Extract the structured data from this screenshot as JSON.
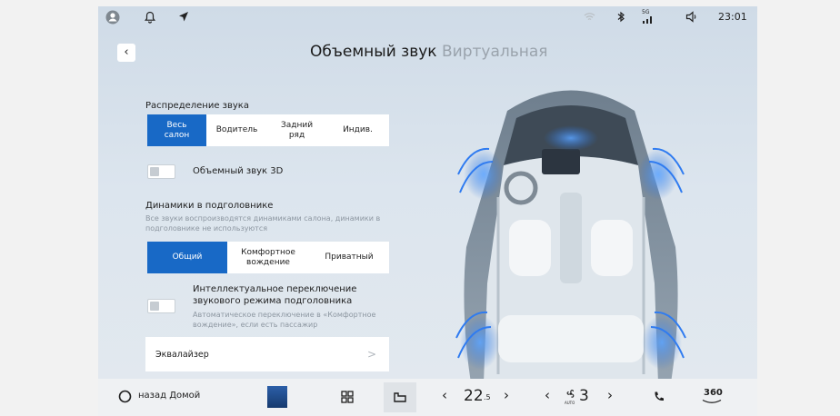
{
  "status_bar": {
    "time": "23:01",
    "signal_label": "5G"
  },
  "header": {
    "back_label": "‹",
    "tabs": [
      {
        "label": "Объемный звук"
      },
      {
        "label": "Виртуальная"
      }
    ]
  },
  "sound_distribution": {
    "label": "Распределение звука",
    "options": [
      {
        "label": "Весь\nсалон",
        "active": true
      },
      {
        "label": "Водитель"
      },
      {
        "label": "Задний\nряд"
      },
      {
        "label": "Индив."
      }
    ]
  },
  "surround_3d": {
    "label": "Объемный звук 3D",
    "enabled": false
  },
  "headrest": {
    "label": "Динамики в подголовнике",
    "description": "Все звуки воспроизводятся динамиками салона, динамики в подголовнике не используются",
    "options": [
      {
        "label": "Общий",
        "active": true
      },
      {
        "label": "Комфортное\nвождение"
      },
      {
        "label": "Приватный"
      }
    ]
  },
  "smart_switch": {
    "label": "Интеллектуальное переключение звукового режима подголовника",
    "description": "Автоматическое переключение в «Комфортное вождение», если есть пассажир",
    "enabled": false
  },
  "equalizer": {
    "label": "Эквалайзер",
    "chevron": ">"
  },
  "dock": {
    "home_label": "назад Домой",
    "temp_left": "22",
    "temp_left_decimal": ".5",
    "fan_level": "3",
    "fan_mode": "AUTO",
    "view_360": "360"
  },
  "colors": {
    "accent": "#1869c6",
    "background": "#d6e0ea"
  }
}
